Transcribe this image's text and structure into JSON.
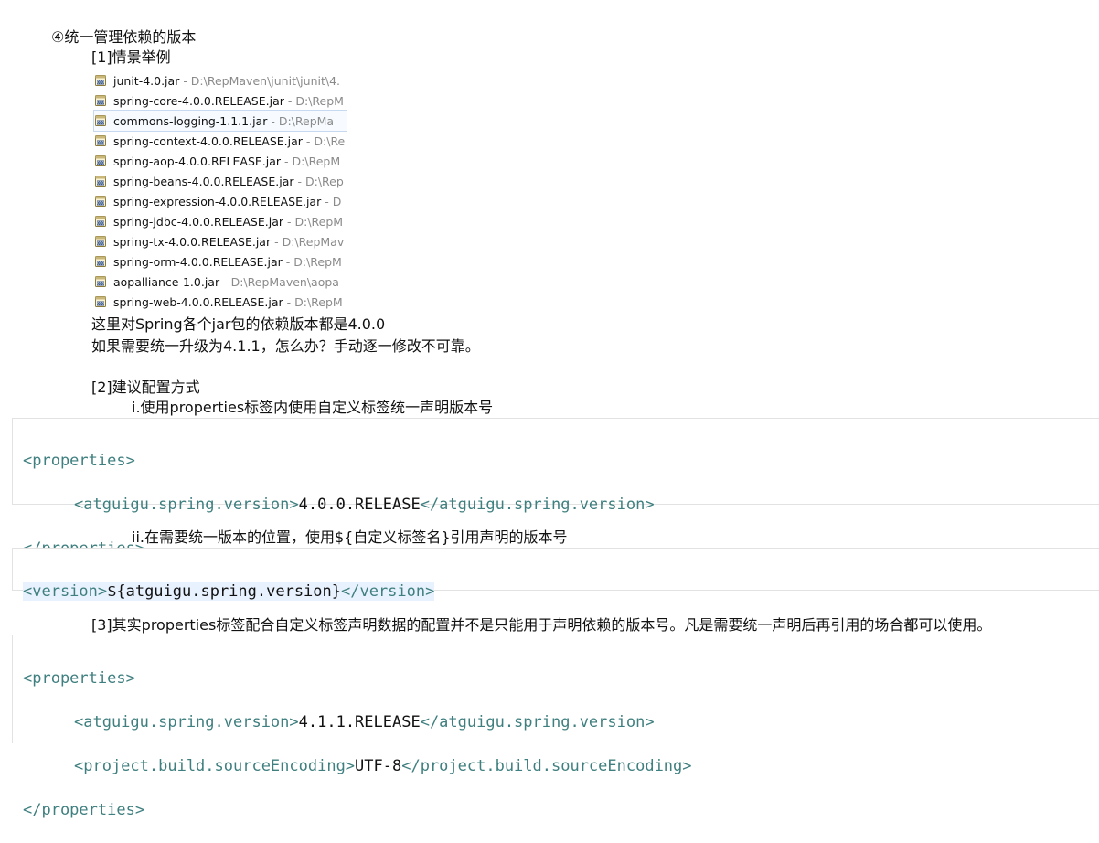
{
  "heading": "④统一管理依赖的版本",
  "section1": {
    "title": "[1]情景举例"
  },
  "jars": [
    {
      "name": "junit-4.0.jar",
      "path": " - D:\\RepMaven\\junit\\junit\\4.",
      "icon": "jar-icon"
    },
    {
      "name": "spring-core-4.0.0.RELEASE.jar",
      "path": " - D:\\RepM",
      "icon": "jar-icon"
    },
    {
      "name": "commons-logging-1.1.1.jar",
      "path": " - D:\\RepMa",
      "icon": "jar-icon"
    },
    {
      "name": "spring-context-4.0.0.RELEASE.jar",
      "path": " - D:\\Re",
      "icon": "jar-icon"
    },
    {
      "name": "spring-aop-4.0.0.RELEASE.jar",
      "path": " - D:\\RepM",
      "icon": "jar-icon"
    },
    {
      "name": "spring-beans-4.0.0.RELEASE.jar",
      "path": " - D:\\Rep",
      "icon": "jar-icon"
    },
    {
      "name": "spring-expression-4.0.0.RELEASE.jar",
      "path": " - D",
      "icon": "jar-icon"
    },
    {
      "name": "spring-jdbc-4.0.0.RELEASE.jar",
      "path": " - D:\\RepM",
      "icon": "jar-icon"
    },
    {
      "name": "spring-tx-4.0.0.RELEASE.jar",
      "path": " - D:\\RepMav",
      "icon": "jar-icon"
    },
    {
      "name": "spring-orm-4.0.0.RELEASE.jar",
      "path": " - D:\\RepM",
      "icon": "jar-icon"
    },
    {
      "name": "aopalliance-1.0.jar",
      "path": " - D:\\RepMaven\\aopa",
      "icon": "jar-icon"
    },
    {
      "name": "spring-web-4.0.0.RELEASE.jar",
      "path": " - D:\\RepM",
      "icon": "jar-icon"
    }
  ],
  "note1": "这里对Spring各个jar包的依赖版本都是4.0.0",
  "note2": "如果需要统一升级为4.1.1，怎么办？手动逐一修改不可靠。",
  "section2": {
    "title": "[2]建议配置方式",
    "step1": "i.使用properties标签内使用自定义标签统一声明版本号",
    "step2": "ii.在需要统一版本的位置，使用${自定义标签名}引用声明的版本号"
  },
  "section3": {
    "text": "[3]其实properties标签配合自定义标签声明数据的配置并不是只能用于声明依赖的版本号。凡是需要统一声明后再引用的场合都可以使用。"
  },
  "code1": {
    "open": "<properties>",
    "tag_open": "<atguigu.spring.version>",
    "value": "4.0.0.RELEASE",
    "tag_close": "</atguigu.spring.version>",
    "close": "</properties>"
  },
  "code2": {
    "open": "<version>",
    "value": "${atguigu.spring.version}",
    "close": "</version>"
  },
  "code3": {
    "open": "<properties>",
    "tag1_open": "<atguigu.spring.version>",
    "tag1_value": "4.1.1.RELEASE",
    "tag1_close": "</atguigu.spring.version>",
    "tag2_open": "<project.build.sourceEncoding>",
    "tag2_value": "UTF-8",
    "tag2_close": "</project.build.sourceEncoding>",
    "close": "</properties>"
  },
  "colors": {
    "xml_tag": "#3f7f7f",
    "highlight": "#e8f2fe",
    "path_gray": "#8a8a8a"
  }
}
